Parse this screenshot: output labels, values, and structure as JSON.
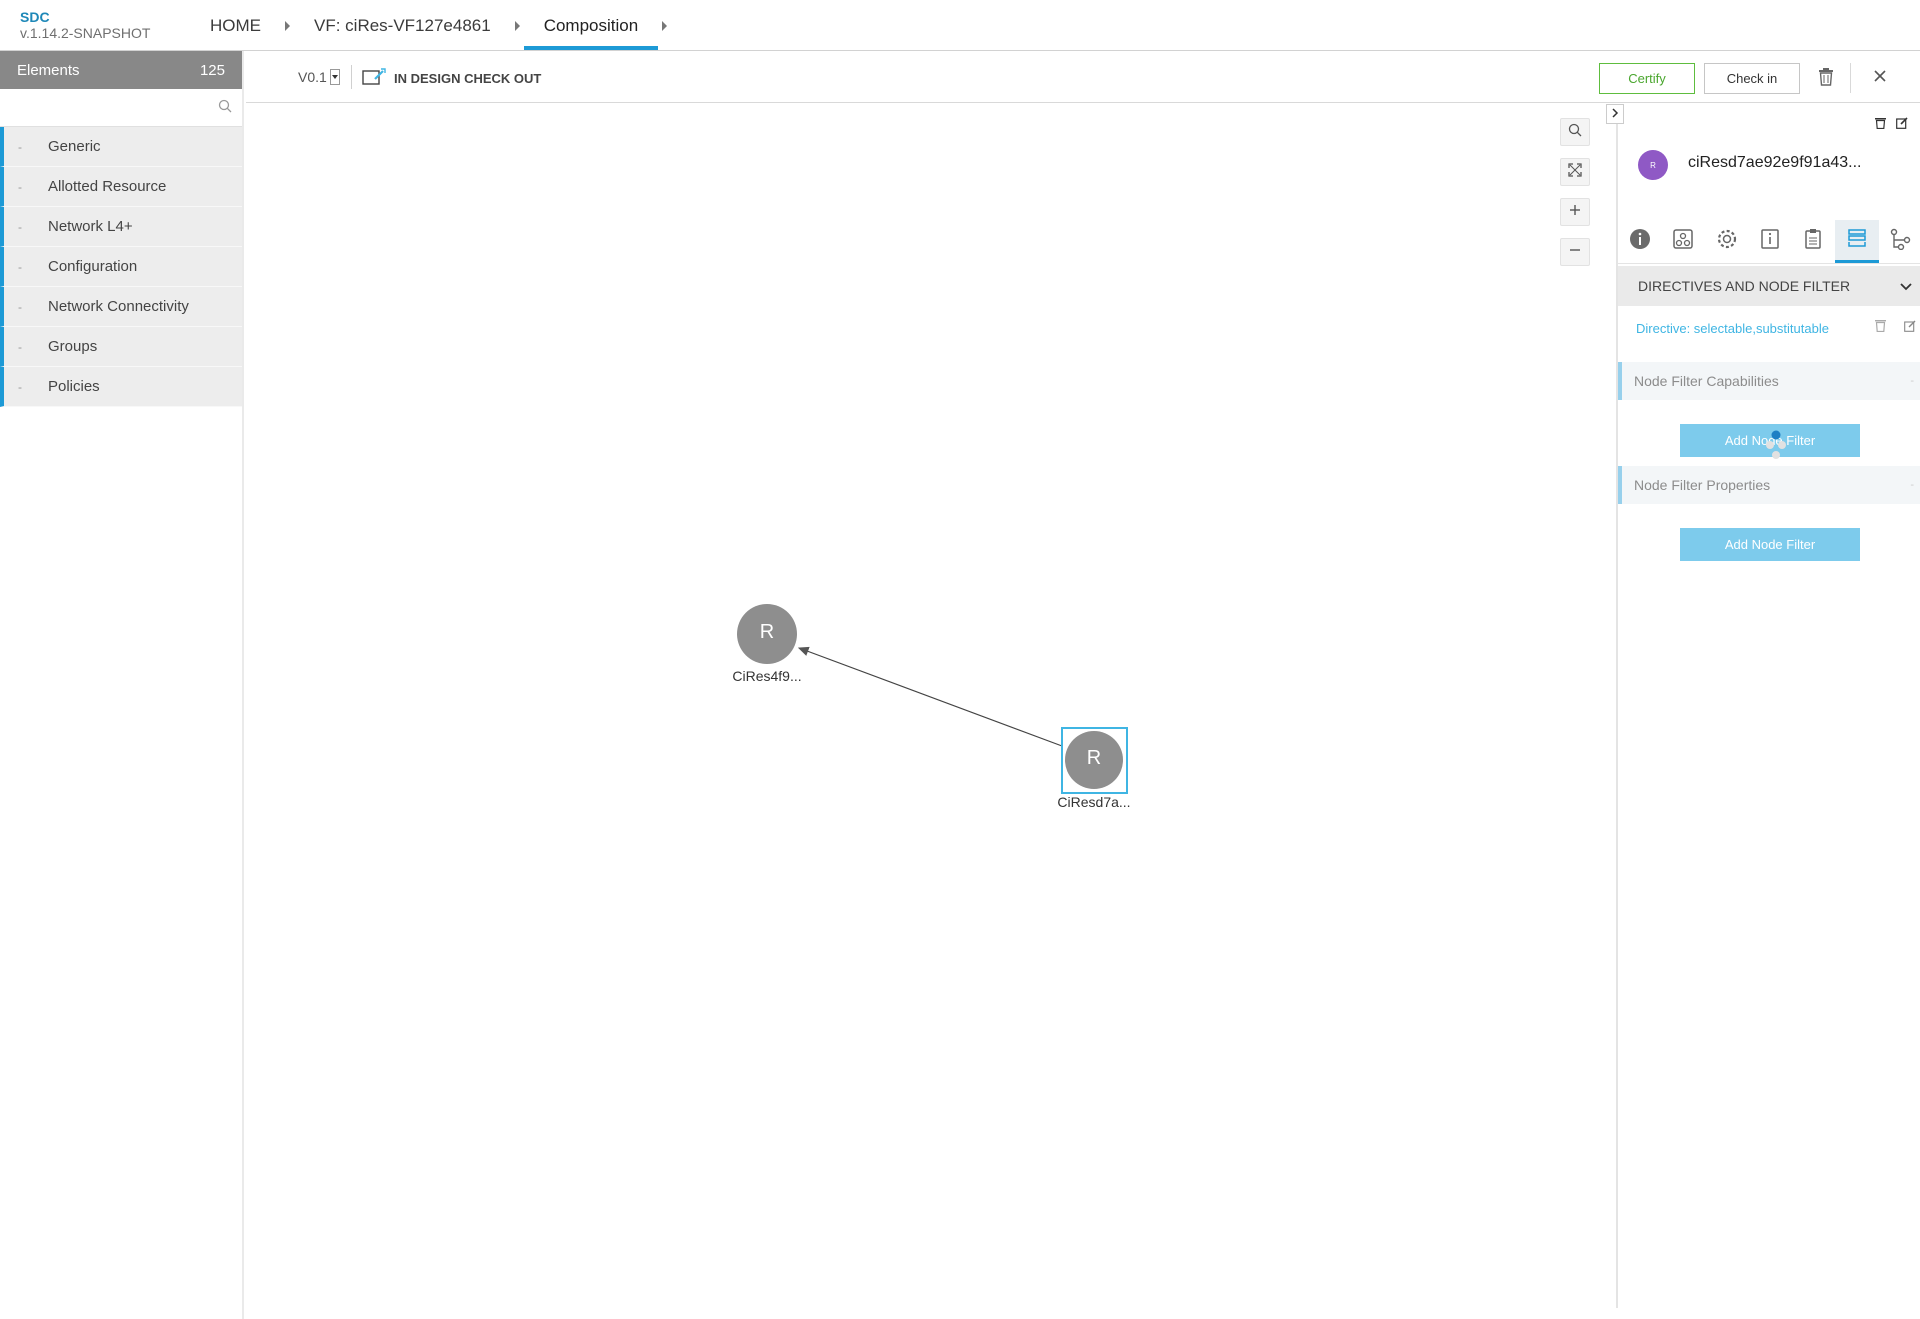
{
  "header": {
    "brand": "SDC",
    "version": "v.1.14.2-SNAPSHOT",
    "breadcrumbs": [
      "HOME",
      "VF: ciRes-VF127e4861",
      "Composition"
    ]
  },
  "palette": {
    "title": "Elements",
    "count": "125",
    "search_placeholder": "",
    "dash": "-",
    "categories": [
      "Generic",
      "Allotted Resource",
      "Network L4+",
      "Configuration",
      "Network Connectivity",
      "Groups",
      "Policies"
    ]
  },
  "toolbar": {
    "version": "V0.1",
    "status": "IN DESIGN CHECK OUT",
    "certify_label": "Certify",
    "checkin_label": "Check in"
  },
  "canvas": {
    "nodes": [
      {
        "letter": "R",
        "label": "CiRes4f9...",
        "selected": false
      },
      {
        "letter": "R",
        "label": "CiResd7a...",
        "selected": true
      }
    ]
  },
  "right_panel": {
    "avatar_letter": "R",
    "title": "ciResd7ae92e9f91a43...",
    "section_title": "DIRECTIVES AND NODE FILTER",
    "directive": "Directive: selectable,substitutable",
    "capabilities_title": "Node Filter Capabilities",
    "properties_title": "Node Filter Properties",
    "add_filter_label": "Add Node Filter",
    "subsection_dash": "-"
  },
  "colors": {
    "accent": "#1d9ad6",
    "certify": "#4aa62e",
    "node_fill": "#8e8e8e",
    "avatar": "#8f59c5",
    "add_button": "#7dcbec"
  }
}
